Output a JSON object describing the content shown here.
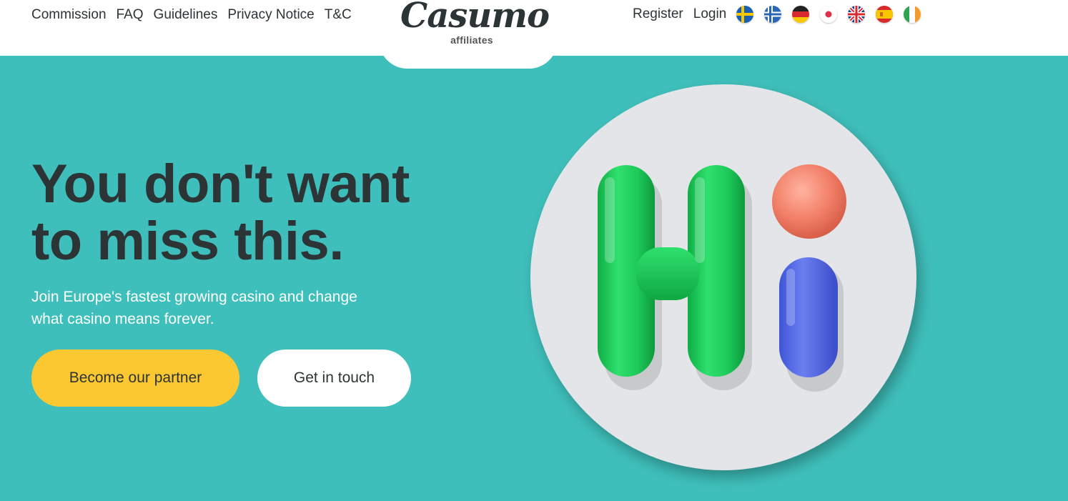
{
  "header": {
    "nav_left": [
      "Commission",
      "FAQ",
      "Guidelines",
      "Privacy Notice",
      "T&C"
    ],
    "logo": {
      "word": "Casumo",
      "sub": "affiliates"
    },
    "nav_right": {
      "register": "Register",
      "login": "Login"
    },
    "flags": [
      "sweden-flag-icon",
      "norway-flag-icon",
      "germany-flag-icon",
      "japan-flag-icon",
      "uk-flag-icon",
      "spain-flag-icon",
      "ireland-flag-icon"
    ]
  },
  "hero": {
    "title_line1": "You don't want",
    "title_line2": "to miss this.",
    "subtitle_line1": "Join Europe's fastest growing casino and change",
    "subtitle_line2": "what casino means forever.",
    "primary_button": "Become our partner",
    "secondary_button": "Get in touch",
    "illustration": "hi-letters-icon"
  },
  "colors": {
    "background": "#3fbfbb",
    "header": "#ffffff",
    "primary_button": "#fcc832",
    "text_dark": "#2d3436",
    "letter_h": "#1ec95a",
    "dot_i": "#f0836e",
    "stem_i": "#5a6ee8"
  }
}
